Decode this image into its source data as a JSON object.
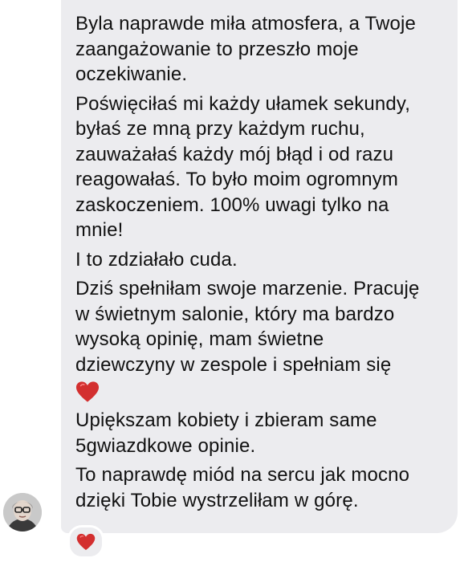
{
  "message": {
    "paragraphs": [
      [
        "Byla naprawde miła atmosfera, a Twoje",
        "zaangażowanie to przeszło moje",
        "oczekiwanie."
      ],
      [
        "Poświęciłaś mi każdy ułamek sekundy,",
        "byłaś ze mną przy każdym ruchu,",
        "zauważałaś każdy mój błąd i od razu",
        "reagowałaś. To było moim ogromnym",
        "zaskoczeniem. 100% uwagi tylko na",
        "mnie!"
      ],
      [
        "I to zdziałało cuda."
      ],
      [
        "Dziś spełniłam swoje marzenie. Pracuję",
        "w świetnym salonie, który ma bardzo",
        "wysoką opinię, mam świetne",
        "dziewczyny w zespole i spełniam się"
      ],
      [
        "Upiększam kobiety i zbieram same",
        "5gwiazdkowe opinie."
      ],
      [
        "To naprawdę miód na sercu jak mocno",
        "dzięki Tobie wystrzeliłam w górę."
      ]
    ],
    "inline_emoji": "red-heart-icon"
  },
  "reaction": {
    "emoji": "red-heart-icon"
  },
  "colors": {
    "bubble_bg": "#ececef",
    "text": "#111111",
    "heart": "#d32f2f"
  }
}
